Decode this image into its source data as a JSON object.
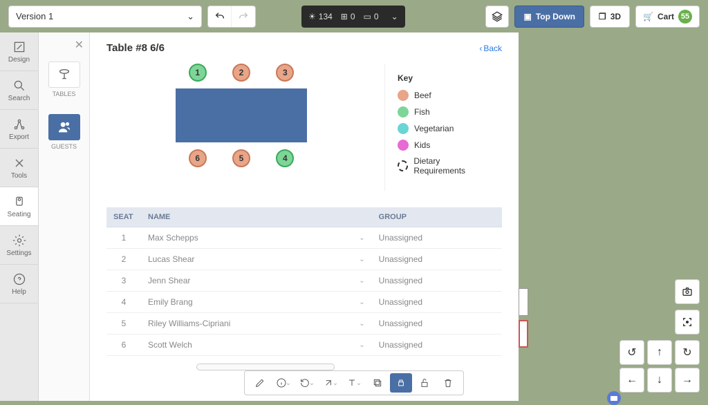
{
  "topbar": {
    "version_label": "Version 1",
    "black": {
      "light_count": "134",
      "grid_count": "0",
      "screen_count": "0"
    },
    "topdown_label": "Top Down",
    "threed_label": "3D",
    "cart_label": "Cart",
    "cart_count": "55"
  },
  "rail": {
    "design": "Design",
    "search": "Search",
    "export": "Export",
    "tools": "Tools",
    "seating": "Seating",
    "settings": "Settings",
    "help": "Help"
  },
  "rail2": {
    "tables": "TABLES",
    "guests": "GUESTS"
  },
  "panel": {
    "title": "Table #8 6/6",
    "back": "Back"
  },
  "seats_top": [
    {
      "num": "1",
      "meal": "fish"
    },
    {
      "num": "2",
      "meal": "beef"
    },
    {
      "num": "3",
      "meal": "beef"
    }
  ],
  "seats_bottom": [
    {
      "num": "6",
      "meal": "beef"
    },
    {
      "num": "5",
      "meal": "beef"
    },
    {
      "num": "4",
      "meal": "fish"
    }
  ],
  "key": {
    "title": "Key",
    "beef": "Beef",
    "fish": "Fish",
    "veg": "Vegetarian",
    "kids": "Kids",
    "dietary": "Dietary Requirements"
  },
  "table": {
    "col_seat": "SEAT",
    "col_name": "NAME",
    "col_group": "GROUP",
    "rows": [
      {
        "seat": "1",
        "name": "Max Schepps",
        "group": "Unassigned"
      },
      {
        "seat": "2",
        "name": "Lucas Shear",
        "group": "Unassigned"
      },
      {
        "seat": "3",
        "name": "Jenn Shear",
        "group": "Unassigned"
      },
      {
        "seat": "4",
        "name": "Emily Brang",
        "group": "Unassigned"
      },
      {
        "seat": "5",
        "name": "Riley Williams-Cipriani",
        "group": "Unassigned"
      },
      {
        "seat": "6",
        "name": "Scott Welch",
        "group": "Unassigned"
      }
    ]
  }
}
